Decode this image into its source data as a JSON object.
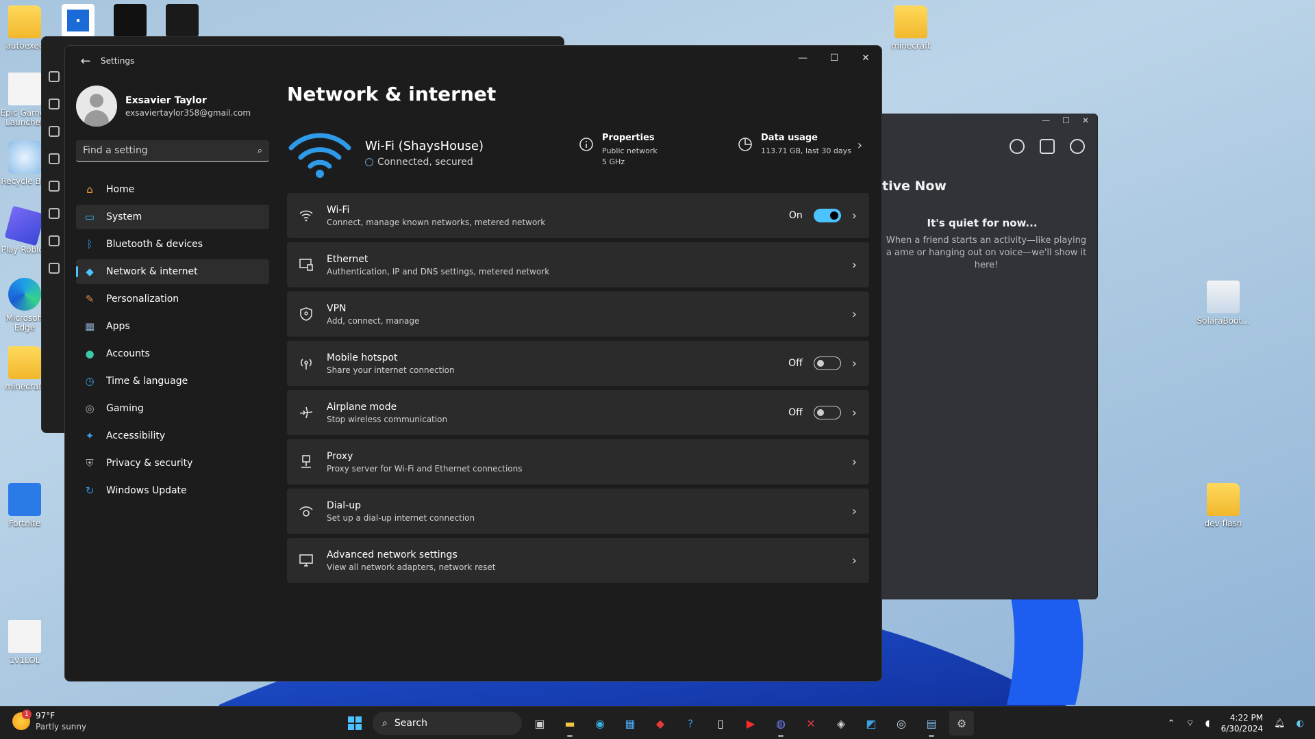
{
  "desktop": {
    "icons_left": [
      {
        "label": "autoexec",
        "kind": "folder"
      },
      {
        "label": "Epic Games Launcher",
        "kind": "file"
      },
      {
        "label": "Recycle Bin",
        "kind": "recycle"
      },
      {
        "label": "Play Roblox",
        "kind": "roblox"
      },
      {
        "label": "Microsoft Edge",
        "kind": "edge"
      },
      {
        "label": "minecraft",
        "kind": "folder"
      },
      {
        "label": "Fortnite",
        "kind": "fortnite"
      },
      {
        "label": "1v1LOL",
        "kind": "file"
      }
    ],
    "icons_top": [
      {
        "label": "",
        "kind": "app-blue"
      },
      {
        "label": "",
        "kind": "cod"
      },
      {
        "label": "",
        "kind": "wolf"
      }
    ],
    "icons_right": [
      {
        "label": "minecraft",
        "kind": "folder"
      },
      {
        "label": "SolaraBoot...",
        "kind": "installer"
      },
      {
        "label": "dev flash",
        "kind": "folder"
      }
    ]
  },
  "discord": {
    "heading": "tive Now",
    "quiet_title": "It's quiet for now...",
    "quiet_text": "When a friend starts an activity—like playing a ame or hanging out on voice—we'll show it here!"
  },
  "settings": {
    "window_title": "Settings",
    "user": {
      "name": "Exsavier Taylor",
      "email": "exsaviertaylor358@gmail.com"
    },
    "search_placeholder": "Find a setting",
    "nav": [
      {
        "label": "Home",
        "icon": "home-icon",
        "color": "#f3a03a"
      },
      {
        "label": "System",
        "icon": "system-icon",
        "color": "#3aa8e8"
      },
      {
        "label": "Bluetooth & devices",
        "icon": "bluetooth-icon",
        "color": "#2f8fe0"
      },
      {
        "label": "Network & internet",
        "icon": "network-icon",
        "color": "#4cc2ff"
      },
      {
        "label": "Personalization",
        "icon": "brush-icon",
        "color": "#e08a4a"
      },
      {
        "label": "Apps",
        "icon": "apps-icon",
        "color": "#8aa4c8"
      },
      {
        "label": "Accounts",
        "icon": "accounts-icon",
        "color": "#3cc8a8"
      },
      {
        "label": "Time & language",
        "icon": "time-language-icon",
        "color": "#3aa0e0"
      },
      {
        "label": "Gaming",
        "icon": "gaming-icon",
        "color": "#b0b0b0"
      },
      {
        "label": "Accessibility",
        "icon": "accessibility-icon",
        "color": "#3a9ee8"
      },
      {
        "label": "Privacy & security",
        "icon": "shield-icon",
        "color": "#9aa0a8"
      },
      {
        "label": "Windows Update",
        "icon": "update-icon",
        "color": "#2f8fe0"
      }
    ],
    "active_index": 1,
    "selected_index": 3,
    "page_title": "Network & internet",
    "hero": {
      "ssid": "Wi-Fi (ShaysHouse)",
      "status": "Connected, secured",
      "properties_title": "Properties",
      "properties_line1": "Public network",
      "properties_line2": "5 GHz",
      "data_title": "Data usage",
      "data_line1": "113.71 GB, last 30 days"
    },
    "rows": [
      {
        "title": "Wi-Fi",
        "sub": "Connect, manage known networks, metered network",
        "icon": "wifi-icon",
        "toggle": "on",
        "state": "On"
      },
      {
        "title": "Ethernet",
        "sub": "Authentication, IP and DNS settings, metered network",
        "icon": "ethernet-icon",
        "toggle": null,
        "state": ""
      },
      {
        "title": "VPN",
        "sub": "Add, connect, manage",
        "icon": "vpn-shield-icon",
        "toggle": null,
        "state": ""
      },
      {
        "title": "Mobile hotspot",
        "sub": "Share your internet connection",
        "icon": "hotspot-icon",
        "toggle": "off",
        "state": "Off"
      },
      {
        "title": "Airplane mode",
        "sub": "Stop wireless communication",
        "icon": "airplane-icon",
        "toggle": "off",
        "state": "Off"
      },
      {
        "title": "Proxy",
        "sub": "Proxy server for Wi-Fi and Ethernet connections",
        "icon": "proxy-icon",
        "toggle": null,
        "state": ""
      },
      {
        "title": "Dial-up",
        "sub": "Set up a dial-up internet connection",
        "icon": "dialup-icon",
        "toggle": null,
        "state": ""
      },
      {
        "title": "Advanced network settings",
        "sub": "View all network adapters, network reset",
        "icon": "monitor-icon",
        "toggle": null,
        "state": ""
      }
    ]
  },
  "taskbar": {
    "weather_temp": "97°F",
    "weather_cond": "Partly sunny",
    "weather_badge": "1",
    "search_label": "Search",
    "time": "4:22 PM",
    "date": "6/30/2024",
    "apps": [
      {
        "name": "task-view-icon",
        "glyph": "▣",
        "color": "#cfcfcf",
        "state": ""
      },
      {
        "name": "file-explorer-icon",
        "glyph": "▬",
        "color": "#f2c744",
        "state": "running"
      },
      {
        "name": "edge-icon",
        "glyph": "◉",
        "color": "#3ab0e0",
        "state": ""
      },
      {
        "name": "store-icon",
        "glyph": "▦",
        "color": "#4aa8f0",
        "state": ""
      },
      {
        "name": "red-app-icon",
        "glyph": "◆",
        "color": "#e83a3a",
        "state": ""
      },
      {
        "name": "help-icon",
        "glyph": "?",
        "color": "#3a9ee8",
        "state": ""
      },
      {
        "name": "notepad-icon",
        "glyph": "▯",
        "color": "#f0f0f0",
        "state": ""
      },
      {
        "name": "youtube-icon",
        "glyph": "▶",
        "color": "#ff2a2a",
        "state": ""
      },
      {
        "name": "discord-icon",
        "glyph": "◍",
        "color": "#6a7ef5",
        "state": "running"
      },
      {
        "name": "x-app-icon",
        "glyph": "✕",
        "color": "#e83a4a",
        "state": ""
      },
      {
        "name": "bm-app-icon",
        "glyph": "◈",
        "color": "#d8d8d8",
        "state": ""
      },
      {
        "name": "photo-app-icon",
        "glyph": "◩",
        "color": "#3aa0e0",
        "state": ""
      },
      {
        "name": "steam-icon",
        "glyph": "◎",
        "color": "#c8d8e8",
        "state": ""
      },
      {
        "name": "task-manager-icon",
        "glyph": "▤",
        "color": "#7ab8e8",
        "state": "running"
      },
      {
        "name": "settings-gear-icon",
        "glyph": "⚙",
        "color": "#c8c8c8",
        "state": "active"
      }
    ]
  }
}
